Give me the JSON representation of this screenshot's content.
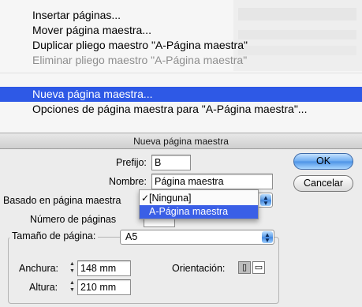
{
  "menu": {
    "items": [
      {
        "label": "Insertar páginas...",
        "state": "normal"
      },
      {
        "label": "Mover página maestra...",
        "state": "normal"
      },
      {
        "label": "Duplicar pliego maestro \"A-Página maestra\"",
        "state": "normal"
      },
      {
        "label": "Eliminar pliego maestro \"A-Página maestra\"",
        "state": "disabled"
      },
      {
        "label": "Nueva página maestra...",
        "state": "selected"
      },
      {
        "label": "Opciones de página maestra para \"A-Página maestra\"...",
        "state": "normal"
      }
    ]
  },
  "dialog": {
    "title": "Nueva página maestra",
    "prefix": {
      "label": "Prefijo:",
      "value": "B"
    },
    "name": {
      "label": "Nombre:",
      "value": "Página maestra"
    },
    "based_on": {
      "label": "Basado en página maestra",
      "options": [
        "[Ninguna]",
        "A-Página maestra"
      ],
      "checked": "[Ninguna]",
      "highlighted": "A-Página maestra"
    },
    "num_pages": {
      "label": "Número de páginas"
    },
    "page_size": {
      "label": "Tamaño de página:",
      "value": "A5"
    },
    "width": {
      "label": "Anchura:",
      "value": "148 mm"
    },
    "height": {
      "label": "Altura:",
      "value": "210 mm"
    },
    "orientation": {
      "label": "Orientación:",
      "selected": "portrait"
    },
    "ok_label": "OK",
    "cancel_label": "Cancelar"
  },
  "colors": {
    "menu_highlight": "#2e59e6",
    "dialog_bg": "#ececec",
    "default_button": "#4b92e6"
  }
}
